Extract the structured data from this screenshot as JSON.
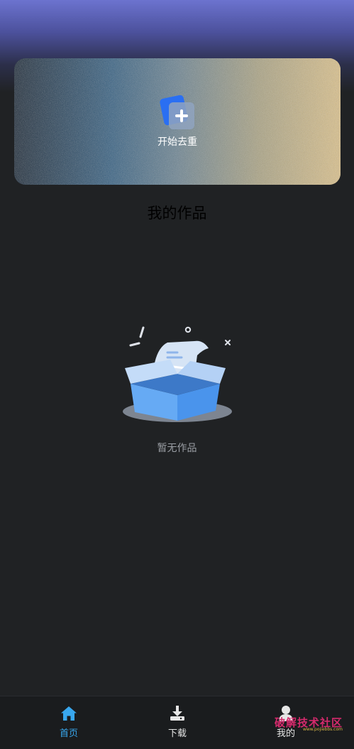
{
  "banner": {
    "start_label": "开始去重",
    "icon": "add-document-icon"
  },
  "section": {
    "title": "我的作品"
  },
  "empty_state": {
    "text": "暂无作品",
    "illustration": "empty-box-illustration"
  },
  "bottom_nav": {
    "items": [
      {
        "label": "首页",
        "icon": "home-icon",
        "active": true
      },
      {
        "label": "下载",
        "icon": "download-icon",
        "active": false
      },
      {
        "label": "我的",
        "icon": "user-icon",
        "active": false
      }
    ]
  },
  "watermark": {
    "text": "破解技术社区",
    "url": "www.pojiebbs.com"
  },
  "colors": {
    "background": "#202224",
    "accent": "#38a7ee",
    "header_gradient_top": "#6c73cf"
  }
}
